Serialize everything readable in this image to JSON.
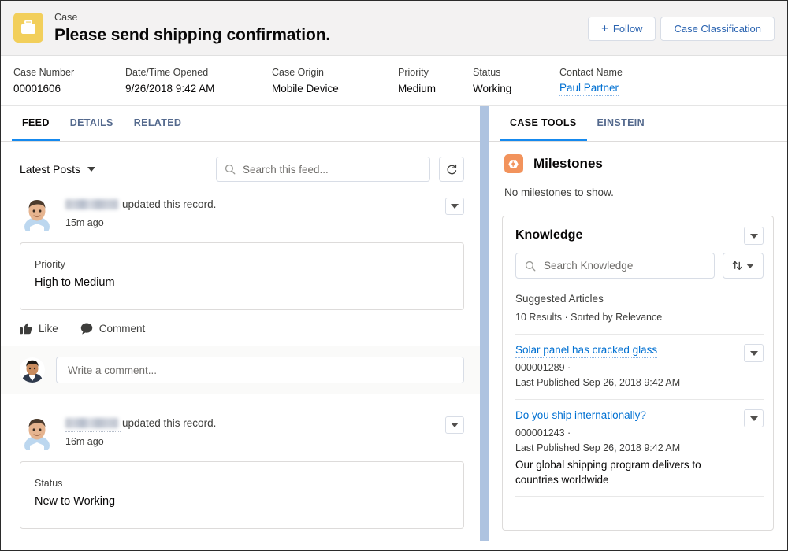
{
  "record_header": {
    "icon": "briefcase-icon",
    "object_label": "Case",
    "title": "Please send shipping confirmation.",
    "actions": {
      "follow_label": "Follow",
      "follow_icon": "plus-icon",
      "case_classification_label": "Case Classification"
    }
  },
  "highlight_fields": [
    {
      "label": "Case Number",
      "value": "00001606",
      "is_link": false
    },
    {
      "label": "Date/Time Opened",
      "value": "9/26/2018 9:42 AM",
      "is_link": false
    },
    {
      "label": "Case Origin",
      "value": "Mobile Device",
      "is_link": false
    },
    {
      "label": "Priority",
      "value": "Medium",
      "is_link": false
    },
    {
      "label": "Status",
      "value": "Working",
      "is_link": false
    },
    {
      "label": "Contact Name",
      "value": "Paul Partner",
      "is_link": true
    }
  ],
  "left_panel": {
    "tabs": [
      {
        "label": "FEED",
        "active": true
      },
      {
        "label": "DETAILS",
        "active": false
      },
      {
        "label": "RELATED",
        "active": false
      }
    ],
    "feed_toolbar": {
      "filter_label": "Latest Posts",
      "filter_icon": "chevron-down-icon",
      "search_placeholder": "Search this feed...",
      "search_value": "",
      "search_icon": "search-icon",
      "refresh_icon": "refresh-icon"
    },
    "posts": [
      {
        "author": "",
        "author_redacted": true,
        "action_text": "updated this record.",
        "timestamp": "15m ago",
        "menu_icon": "chevron-down-icon",
        "change": {
          "label": "Priority",
          "value": "High to Medium"
        },
        "actions": [
          {
            "label": "Like",
            "icon": "thumbs-up-icon"
          },
          {
            "label": "Comment",
            "icon": "comment-bubble-icon"
          }
        ],
        "comment_box": {
          "placeholder": "Write a comment...",
          "value": ""
        }
      },
      {
        "author": "",
        "author_redacted": true,
        "action_text": "updated this record.",
        "timestamp": "16m ago",
        "menu_icon": "chevron-down-icon",
        "change": {
          "label": "Status",
          "value": "New to Working"
        }
      }
    ]
  },
  "right_panel": {
    "tabs": [
      {
        "label": "CASE TOOLS",
        "active": true
      },
      {
        "label": "EINSTEIN",
        "active": false
      }
    ],
    "milestones": {
      "icon": "milestone-icon",
      "title": "Milestones",
      "empty_text": "No milestones to show."
    },
    "knowledge": {
      "title": "Knowledge",
      "menu_icon": "chevron-down-icon",
      "search_placeholder": "Search Knowledge",
      "search_value": "",
      "search_icon": "search-icon",
      "sort_icon": "sort-arrows-icon",
      "sort_caret_icon": "chevron-down-icon",
      "suggested_heading": "Suggested Articles",
      "results_summary": "10 Results · Sorted by Relevance",
      "articles": [
        {
          "title": "Solar panel has cracked glass",
          "number": "000001289 ·",
          "published": "Last Published  Sep 26, 2018 9:42 AM",
          "snippet": "",
          "menu_icon": "chevron-down-icon"
        },
        {
          "title": "Do you ship internationally?",
          "number": "000001243 ·",
          "published": "Last Published  Sep 26, 2018 9:42 AM",
          "snippet": "Our global shipping program delivers to countries worldwide",
          "menu_icon": "chevron-down-icon"
        }
      ]
    }
  },
  "colors": {
    "case_icon_bg": "#f2cf5b",
    "milestone_icon_bg": "#f2935c",
    "link_blue": "#0070d2",
    "active_tab_underline": "#1589ee",
    "divider_blue": "#aec3e0",
    "header_bg": "#f3f2f2"
  }
}
